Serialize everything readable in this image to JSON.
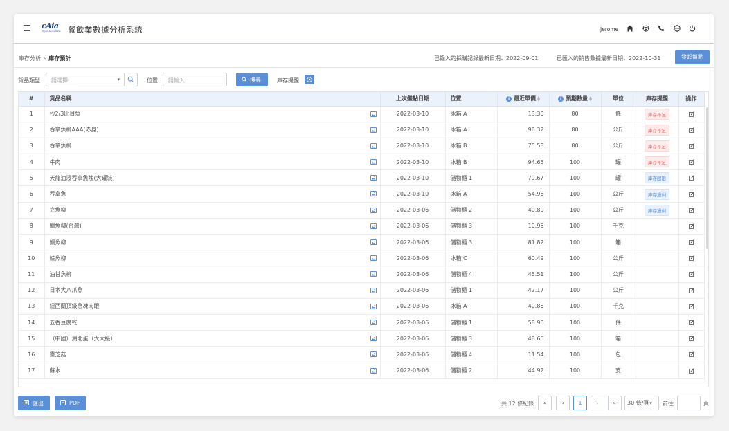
{
  "header": {
    "logo_mark": "cAia",
    "logo_sub": "City of Accounting",
    "app_title": "餐飲業數據分析系統",
    "user": "Jerome",
    "icons": [
      "home-icon",
      "gear-icon",
      "phone-icon",
      "globe-icon",
      "power-icon"
    ]
  },
  "breadcrumb": {
    "parent": "庫存分析",
    "sep": "›",
    "current": "庫存預計"
  },
  "dates": {
    "purchase": "已錄入的採購記錄最新日期：2022-09-01",
    "sales": "已匯入的銷售數據最新日期：2022-10-31"
  },
  "actions": {
    "stocktake_label": "發起盤點"
  },
  "filters": {
    "category_label": "貨品類型",
    "category_placeholder": "請選擇",
    "location_label": "位置",
    "location_placeholder": "請輸入",
    "search_label": "搜尋",
    "alert_label": "庫存提醒"
  },
  "table": {
    "headers": [
      "#",
      "貨品名稱",
      "上次盤點日期",
      "位置",
      "最近單價",
      "預期數量",
      "單位",
      "庫存提醒",
      "操作"
    ],
    "rows": [
      {
        "no": "1",
        "name": "抄2/3比目魚",
        "date": "2022-03-10",
        "loc": "冰箱 A",
        "price": "13.30",
        "qty": "80",
        "unit": "條",
        "alert": "庫存不足",
        "alert_type": "low"
      },
      {
        "no": "2",
        "name": "吞拿魚柳AAA(赤身)",
        "date": "2022-03-10",
        "loc": "冰箱 A",
        "price": "96.32",
        "qty": "80",
        "unit": "公斤",
        "alert": "庫存不足",
        "alert_type": "low"
      },
      {
        "no": "3",
        "name": "吞拿魚柳",
        "date": "2022-03-10",
        "loc": "冰箱 B",
        "price": "75.58",
        "qty": "80",
        "unit": "公斤",
        "alert": "庫存不足",
        "alert_type": "low"
      },
      {
        "no": "4",
        "name": "牛肉",
        "date": "2022-03-10",
        "loc": "冰箱 B",
        "price": "94.65",
        "qty": "100",
        "unit": "罐",
        "alert": "庫存不足",
        "alert_type": "low"
      },
      {
        "no": "5",
        "name": "天龍油浸吞拿魚塊(大罐裝)",
        "date": "2022-03-10",
        "loc": "儲物櫃 1",
        "price": "79.67",
        "qty": "100",
        "unit": "罐",
        "alert": "庫存超限",
        "alert_type": "over"
      },
      {
        "no": "6",
        "name": "吞拿魚",
        "date": "2022-03-10",
        "loc": "冰箱 A",
        "price": "54.96",
        "qty": "100",
        "unit": "公斤",
        "alert": "庫存過剩",
        "alert_type": "over"
      },
      {
        "no": "7",
        "name": "立魚柳",
        "date": "2022-03-06",
        "loc": "儲物櫃 2",
        "price": "40.80",
        "qty": "100",
        "unit": "公斤",
        "alert": "庫存過剩",
        "alert_type": "over"
      },
      {
        "no": "8",
        "name": "鯛魚柳(台灣)",
        "date": "2022-03-06",
        "loc": "儲物櫃 3",
        "price": "10.96",
        "qty": "100",
        "unit": "千克",
        "alert": "",
        "alert_type": ""
      },
      {
        "no": "9",
        "name": "鯛魚柳",
        "date": "2022-03-06",
        "loc": "儲物櫃 3",
        "price": "81.82",
        "qty": "100",
        "unit": "箱",
        "alert": "",
        "alert_type": ""
      },
      {
        "no": "10",
        "name": "鯇魚柳",
        "date": "2022-03-06",
        "loc": "冰箱 C",
        "price": "60.49",
        "qty": "100",
        "unit": "公斤",
        "alert": "",
        "alert_type": ""
      },
      {
        "no": "11",
        "name": "油甘魚柳",
        "date": "2022-03-06",
        "loc": "儲物櫃 4",
        "price": "45.51",
        "qty": "100",
        "unit": "公斤",
        "alert": "",
        "alert_type": ""
      },
      {
        "no": "12",
        "name": "日本大八爪魚",
        "date": "2022-03-06",
        "loc": "儲物櫃 1",
        "price": "42.17",
        "qty": "100",
        "unit": "公斤",
        "alert": "",
        "alert_type": ""
      },
      {
        "no": "13",
        "name": "紐西蘭頂級急凍肉眼",
        "date": "2022-03-06",
        "loc": "冰箱 A",
        "price": "40.86",
        "qty": "100",
        "unit": "千克",
        "alert": "",
        "alert_type": ""
      },
      {
        "no": "14",
        "name": "五香豆腐乾",
        "date": "2022-03-06",
        "loc": "儲物櫃 1",
        "price": "58.90",
        "qty": "100",
        "unit": "件",
        "alert": "",
        "alert_type": ""
      },
      {
        "no": "15",
        "name": "（中國）湖北蛋（大大級）",
        "date": "2022-03-06",
        "loc": "儲物櫃 3",
        "price": "48.66",
        "qty": "100",
        "unit": "箱",
        "alert": "",
        "alert_type": ""
      },
      {
        "no": "16",
        "name": "靈芝菇",
        "date": "2022-03-06",
        "loc": "儲物櫃 4",
        "price": "11.54",
        "qty": "100",
        "unit": "包",
        "alert": "",
        "alert_type": ""
      },
      {
        "no": "17",
        "name": "蘇水",
        "date": "2022-03-06",
        "loc": "儲物櫃 2",
        "price": "44.92",
        "qty": "100",
        "unit": "支",
        "alert": "",
        "alert_type": ""
      }
    ]
  },
  "footer": {
    "export_label": "匯出",
    "pdf_label": "PDF",
    "total": "共 12 條紀錄",
    "first": "«",
    "prev": "‹",
    "page": "1",
    "next": "›",
    "last": "»",
    "page_size": "30 條/頁",
    "goto_label": "前往",
    "page_suffix": "頁"
  },
  "colors": {
    "accent": "#5b8fd8",
    "low": "#e57373",
    "header_bg": "#ecf2fb"
  }
}
